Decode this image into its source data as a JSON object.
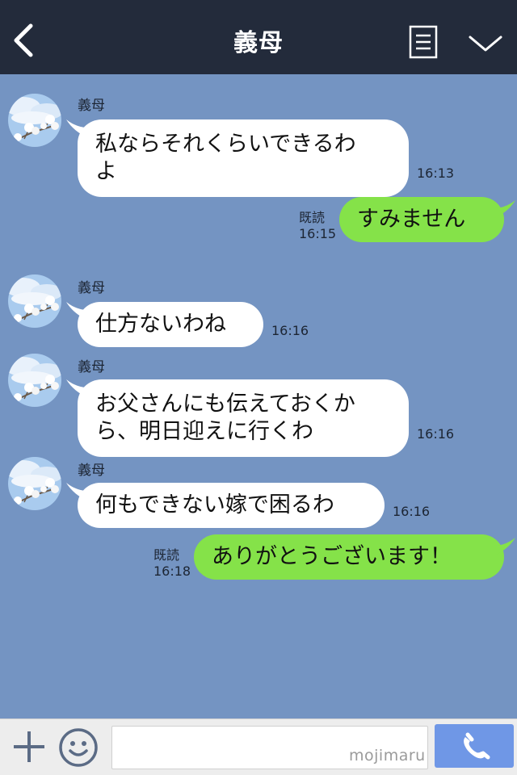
{
  "header": {
    "title": "義母"
  },
  "messages": [
    {
      "direction": "in",
      "sender": "義母",
      "text_lines": [
        "私ならそれくらいできるわ",
        "よ"
      ],
      "time": "16:13"
    },
    {
      "direction": "out",
      "read": "既読",
      "text": "すみません",
      "time": "16:15"
    },
    {
      "direction": "in",
      "sender": "義母",
      "text": "仕方ないわね",
      "time": "16:16"
    },
    {
      "direction": "in",
      "sender": "義母",
      "text_lines": [
        "お父さんにも伝えておくか",
        "ら、明日迎えに行くわ"
      ],
      "time": "16:16"
    },
    {
      "direction": "in",
      "sender": "義母",
      "text": "何もできない嫁で困るわ",
      "time": "16:16"
    },
    {
      "direction": "out",
      "read": "既読",
      "text": "ありがとうございます！",
      "time": "16:18"
    }
  ],
  "footer": {
    "input_value": "",
    "watermark": "mojimaru"
  },
  "icons": {
    "back": "chevron-left-icon",
    "menu": "menu-list-icon",
    "collapse": "chevron-down-icon",
    "add": "plus-icon",
    "emoji": "smiley-icon",
    "call": "phone-icon",
    "avatar": "cherry-blossom-avatar"
  },
  "colors": {
    "header_bg": "#232b3b",
    "chat_bg": "#7494c2",
    "bubble_in": "#ffffff",
    "bubble_out": "#85e249",
    "call_button": "#6f97e6"
  }
}
